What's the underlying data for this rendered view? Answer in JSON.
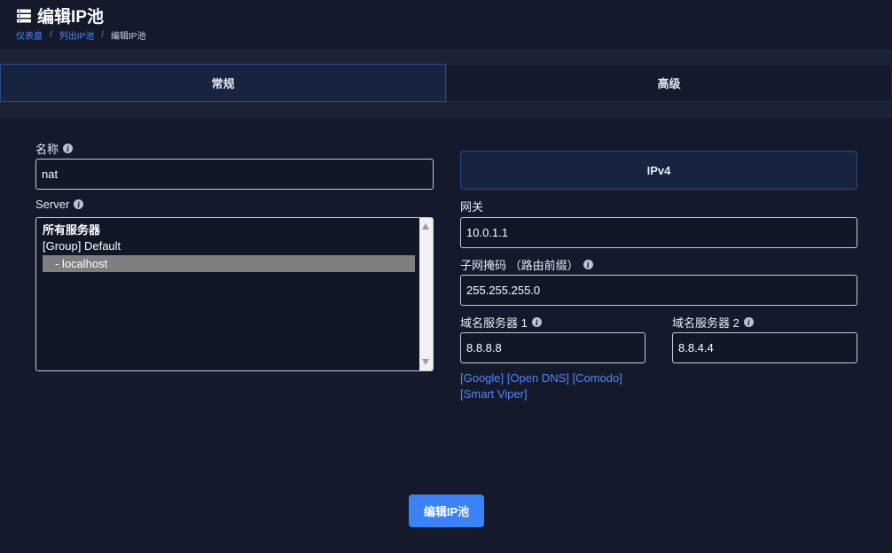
{
  "header": {
    "icon": "server-stack-icon",
    "title": "编辑IP池",
    "breadcrumb": {
      "home": "仪表盘",
      "list": "列出IP池",
      "current": "编辑IP池",
      "separator": "/"
    }
  },
  "tabs": [
    {
      "label": "常规",
      "active": true
    },
    {
      "label": "高级",
      "active": false
    }
  ],
  "form": {
    "name": {
      "label": "名称",
      "value": "nat"
    },
    "server": {
      "label": "Server",
      "options": [
        {
          "text": "所有服务器",
          "type": "group"
        },
        {
          "text": "[Group] Default",
          "type": "option"
        },
        {
          "text": "- localhost",
          "type": "option",
          "selected": true
        }
      ]
    },
    "ipv4": {
      "section_title": "IPv4",
      "gateway": {
        "label": "网关",
        "value": "10.0.1.1"
      },
      "netmask": {
        "label": "子网掩码 （路由前缀）",
        "value": "255.255.255.0"
      },
      "dns1": {
        "label": "域名服务器 1",
        "value": "8.8.8.8"
      },
      "dns2": {
        "label": "域名服务器 2",
        "value": "8.8.4.4"
      },
      "dns_presets": [
        "[Google]",
        "[Open DNS]",
        "[Comodo]",
        "[Smart Viper]"
      ]
    },
    "submit_label": "编辑IP池"
  },
  "colors": {
    "background": "#1b2235",
    "panel": "#141a2b",
    "accent": "#3b82f6",
    "link": "#4d86ff",
    "active_tab": "#16243f"
  }
}
